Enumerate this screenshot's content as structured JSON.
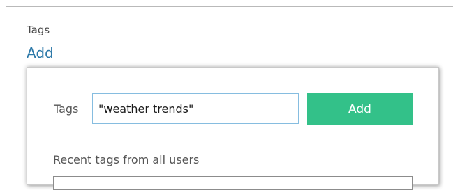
{
  "section": {
    "title": "Tags",
    "add_link": "Add"
  },
  "popup": {
    "tags_label": "Tags",
    "tags_input_value": "\"weather trends\"",
    "add_button_label": "Add",
    "recent_tags_label": "Recent tags from all users"
  },
  "colors": {
    "link": "#2b78a8",
    "add_button": "#33c189",
    "input_border": "#86bde0"
  }
}
